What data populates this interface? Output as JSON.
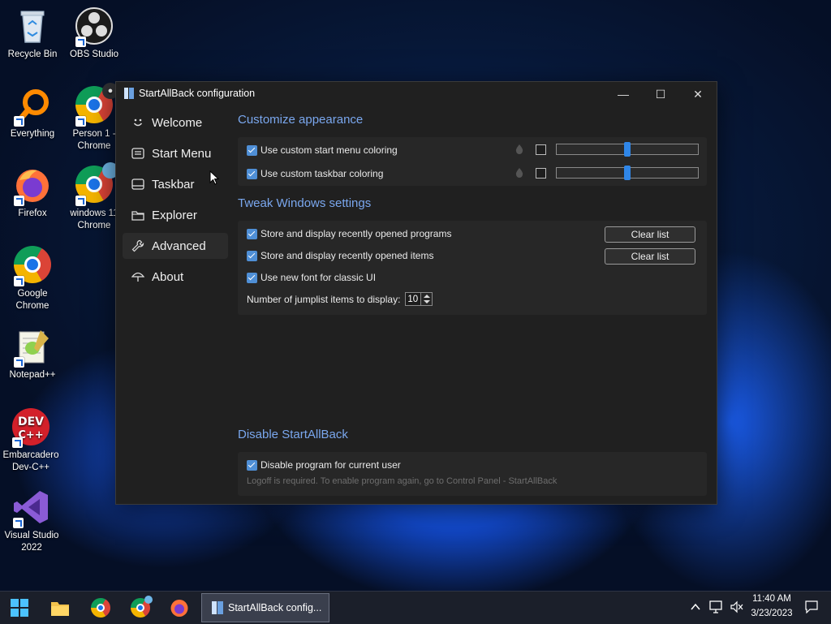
{
  "desktop": {
    "icons": [
      {
        "label": "Recycle Bin"
      },
      {
        "label": "OBS Studio"
      },
      {
        "label": "Everything"
      },
      {
        "label": "Person 1 - Chrome"
      },
      {
        "label": "Firefox"
      },
      {
        "label": "windows 11 Chrome"
      },
      {
        "label": "Google Chrome"
      },
      {
        "label": "Notepad++"
      },
      {
        "label": "Embarcadero Dev-C++"
      },
      {
        "label": "Visual Studio 2022"
      }
    ]
  },
  "window": {
    "title": "StartAllBack configuration",
    "controls": {
      "minimize": "—",
      "maximize": "☐",
      "close": "✕"
    },
    "nav": [
      {
        "label": "Welcome",
        "icon": "smiley-icon"
      },
      {
        "label": "Start Menu",
        "icon": "start-menu-icon"
      },
      {
        "label": "Taskbar",
        "icon": "taskbar-icon"
      },
      {
        "label": "Explorer",
        "icon": "folder-icon"
      },
      {
        "label": "Advanced",
        "icon": "wrench-icon"
      },
      {
        "label": "About",
        "icon": "umbrella-icon"
      }
    ],
    "active_nav": "Advanced",
    "sections": {
      "appearance": {
        "title": "Customize appearance",
        "start_menu_coloring": {
          "label": "Use custom start menu coloring",
          "checked": true,
          "slider_value": 0.5
        },
        "taskbar_coloring": {
          "label": "Use custom taskbar coloring",
          "checked": true,
          "slider_value": 0.5
        }
      },
      "tweak": {
        "title": "Tweak Windows settings",
        "recent_programs": {
          "label": "Store and display recently opened programs",
          "checked": true,
          "button": "Clear list"
        },
        "recent_items": {
          "label": "Store and display recently opened items",
          "checked": true,
          "button": "Clear list"
        },
        "new_font": {
          "label": "Use new font for classic UI",
          "checked": true
        },
        "jumplist": {
          "label": "Number of jumplist items to display:",
          "value": "10"
        }
      },
      "disable": {
        "title": "Disable StartAllBack",
        "disable_program": {
          "label": "Disable program for current user",
          "checked": true
        },
        "hint": "Logoff is required. To enable program again, go to Control Panel - StartAllBack"
      }
    }
  },
  "taskbar": {
    "active_app": "StartAllBack config...",
    "time": "11:40 AM",
    "date": "3/23/2023"
  },
  "colors": {
    "accent": "#7aa7ee",
    "checkbox": "#4f8fd6",
    "slider_thumb": "#2f86e8",
    "window_bg": "#202020"
  }
}
